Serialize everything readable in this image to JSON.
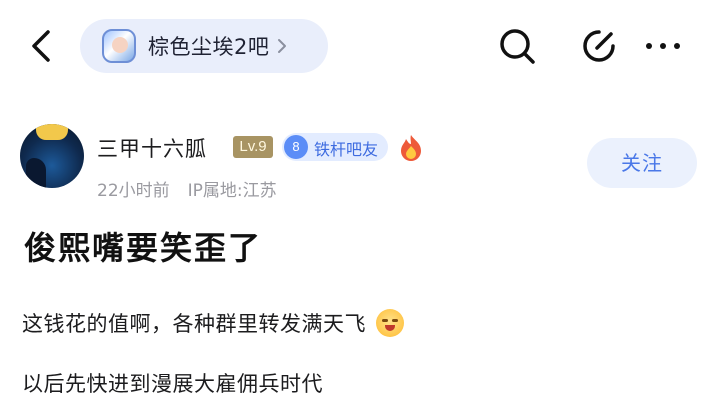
{
  "header": {
    "forum_name": "棕色尘埃2吧",
    "icons": [
      "back-arrow-icon",
      "chevron-right-icon",
      "search-icon",
      "edit-icon",
      "more-icon"
    ]
  },
  "author": {
    "username": "三甲十六胍",
    "level": "Lv.9",
    "member_level": "8",
    "member_title": "铁杆吧友",
    "time": "22小时前",
    "ip": "IP属地:江苏",
    "follow_label": "关注"
  },
  "post": {
    "title": "俊熙嘴要笑歪了",
    "lines": [
      "这钱花的值啊，各种群里转发满天飞",
      "以后先快进到漫展大雇佣兵时代"
    ]
  },
  "colors": {
    "accent": "#4a78e8",
    "pill_bg": "#e9eefb",
    "level_badge": "#a89463",
    "member_badge_bg": "#e3ecff"
  }
}
